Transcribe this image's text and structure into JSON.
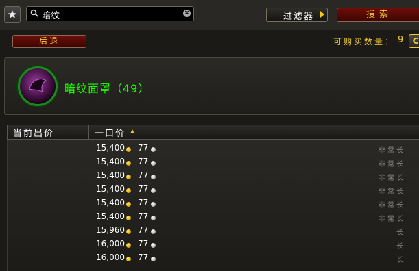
{
  "toolbar": {
    "search_value": "暗纹",
    "filter_label": "过滤器",
    "search_label": "搜索",
    "back_label": "后退",
    "buyable_label": "可购买数量：",
    "buyable_count": "9",
    "max_label": "C"
  },
  "item": {
    "name": "暗纹面罩（49）",
    "icon": "dark-mask-icon"
  },
  "columns": {
    "current_bid": "当前出价",
    "buyout": "一口价"
  },
  "listings": [
    {
      "gold": "15,400",
      "silver": "77",
      "duration": "非常长"
    },
    {
      "gold": "15,400",
      "silver": "77",
      "duration": "非常长"
    },
    {
      "gold": "15,400",
      "silver": "77",
      "duration": "非常长"
    },
    {
      "gold": "15,400",
      "silver": "77",
      "duration": "非常长"
    },
    {
      "gold": "15,400",
      "silver": "77",
      "duration": "非常长"
    },
    {
      "gold": "15,400",
      "silver": "77",
      "duration": "非常长"
    },
    {
      "gold": "15,960",
      "silver": "77",
      "duration": "长"
    },
    {
      "gold": "16,000",
      "silver": "77",
      "duration": "长"
    },
    {
      "gold": "16,000",
      "silver": "77",
      "duration": "长"
    }
  ],
  "colors": {
    "gold_text": "#f0c832",
    "item_quality": "#1eff00",
    "button_red": "#6e0e08"
  }
}
